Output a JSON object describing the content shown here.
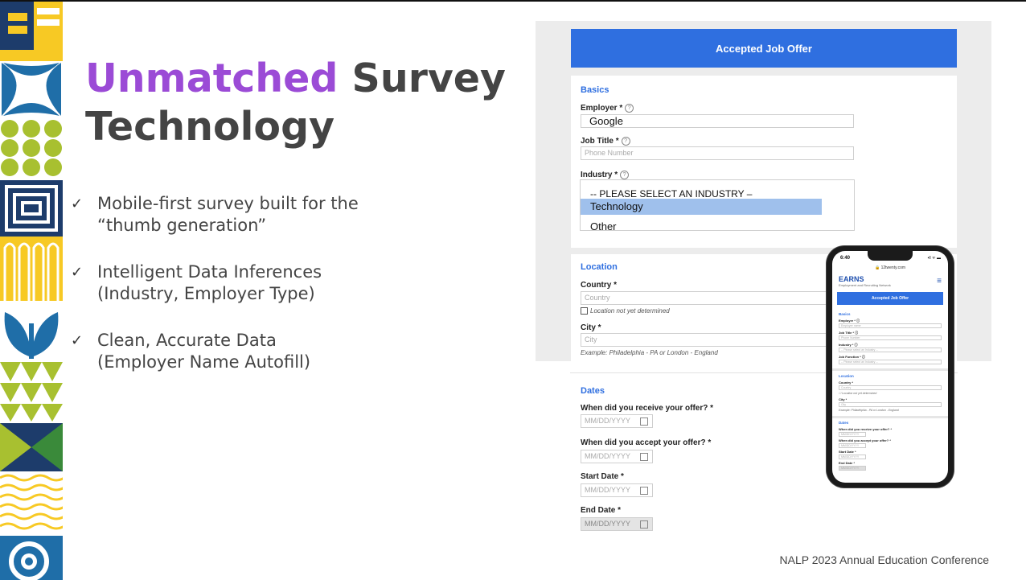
{
  "slide": {
    "title_accent": "Unmatched",
    "title_rest": " Survey Technology",
    "bullets": [
      {
        "line1": "Mobile-first survey built for the",
        "line2": "“thumb generation”"
      },
      {
        "line1": "Intelligent Data Inferences",
        "line2": "(Industry, Employer Type)"
      },
      {
        "line1": "Clean, Accurate Data",
        "line2": "(Employer Name Autofill)"
      }
    ],
    "check_glyph": "✓",
    "footer": "NALP 2023 Annual Education Conference",
    "colors": {
      "accent": "#9b4bd6",
      "title_gray": "#444444",
      "form_blue": "#2f6fe0",
      "selected_option": "#9fc0ec"
    }
  },
  "form": {
    "header": "Accepted Job Offer",
    "basics": {
      "title": "Basics",
      "employer_label": "Employer *",
      "employer_value": "Google",
      "job_title_label": "Job Title *",
      "job_title_placeholder": "Phone Number",
      "industry_label": "Industry *",
      "industry_options": [
        "-- PLEASE SELECT AN INDUSTRY –",
        "Technology",
        "Other"
      ]
    },
    "location": {
      "title": "Location",
      "country_label": "Country *",
      "country_placeholder": "Country",
      "not_determined": "Location not yet determined",
      "city_label": "City *",
      "city_placeholder": "City",
      "city_example": "Example: Philadelphia - PA or London - England"
    },
    "dates": {
      "title": "Dates",
      "received_label": "When did you receive your offer? *",
      "accepted_label": "When did you accept your offer? *",
      "start_label": "Start Date *",
      "end_label": "End Date *",
      "date_placeholder": "MM/DD/YYYY"
    }
  },
  "phone": {
    "time": "6:40",
    "status": "▪ll ᯤ ▬",
    "url": "🔒 12twenty.com",
    "brand": "EARNS",
    "brand_sub": "Employment and Recruiting Network",
    "header": "Accepted Job Offer",
    "basics": "Basics",
    "employer": "Employer * ⓘ",
    "employer_ph": "Employer name",
    "job_title": "Job Title * ⓘ",
    "job_title_ph": "Phone Number",
    "industry": "Industry * ⓘ",
    "industry_ph": "-- Please select an Industry --",
    "job_function": "Job Function * ⓘ",
    "job_function_ph": "-- Please select an Industry --",
    "location": "Location",
    "country": "Country *",
    "country_ph": "Country",
    "not_determined": "☐ Location not yet determined",
    "city": "City *",
    "city_ph": "City",
    "city_ex": "Example: Philadelphia - PA or London - England",
    "dates": "Dates",
    "received": "When did you receive your offer? *",
    "accepted": "When did you accept your offer? *",
    "start": "Start Date *",
    "end": "End Date *",
    "date_ph": "MM/DD/YYYY"
  }
}
